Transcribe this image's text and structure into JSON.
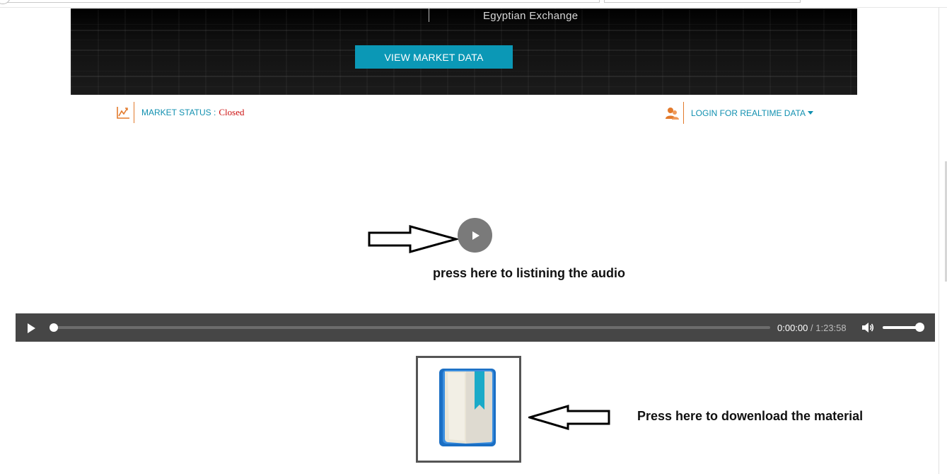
{
  "hero": {
    "subtitle": "Egyptian Exchange",
    "cta_label": "VIEW MARKET DATA"
  },
  "status": {
    "market_label": "MARKET STATUS :",
    "market_value": "Closed",
    "login_label": "LOGIN FOR REALTIME DATA"
  },
  "annotations": {
    "audio_hint": "press here to listining the audio",
    "download_hint": "Press here to dowenload the material"
  },
  "player": {
    "current_time": "0:00:00",
    "separator": "/",
    "duration": "1:23:58",
    "progress": 0,
    "volume": 1.0
  },
  "icons": {
    "market": "line-chart-icon",
    "login": "users-icon",
    "big_play": "play-icon",
    "player_play": "play-icon",
    "volume": "volume-icon",
    "material": "book-icon"
  },
  "colors": {
    "accent": "#0b98b6",
    "link": "#1190b0",
    "divider": "#e37a2c",
    "closed": "#cc1010",
    "player_bg": "#464646"
  }
}
